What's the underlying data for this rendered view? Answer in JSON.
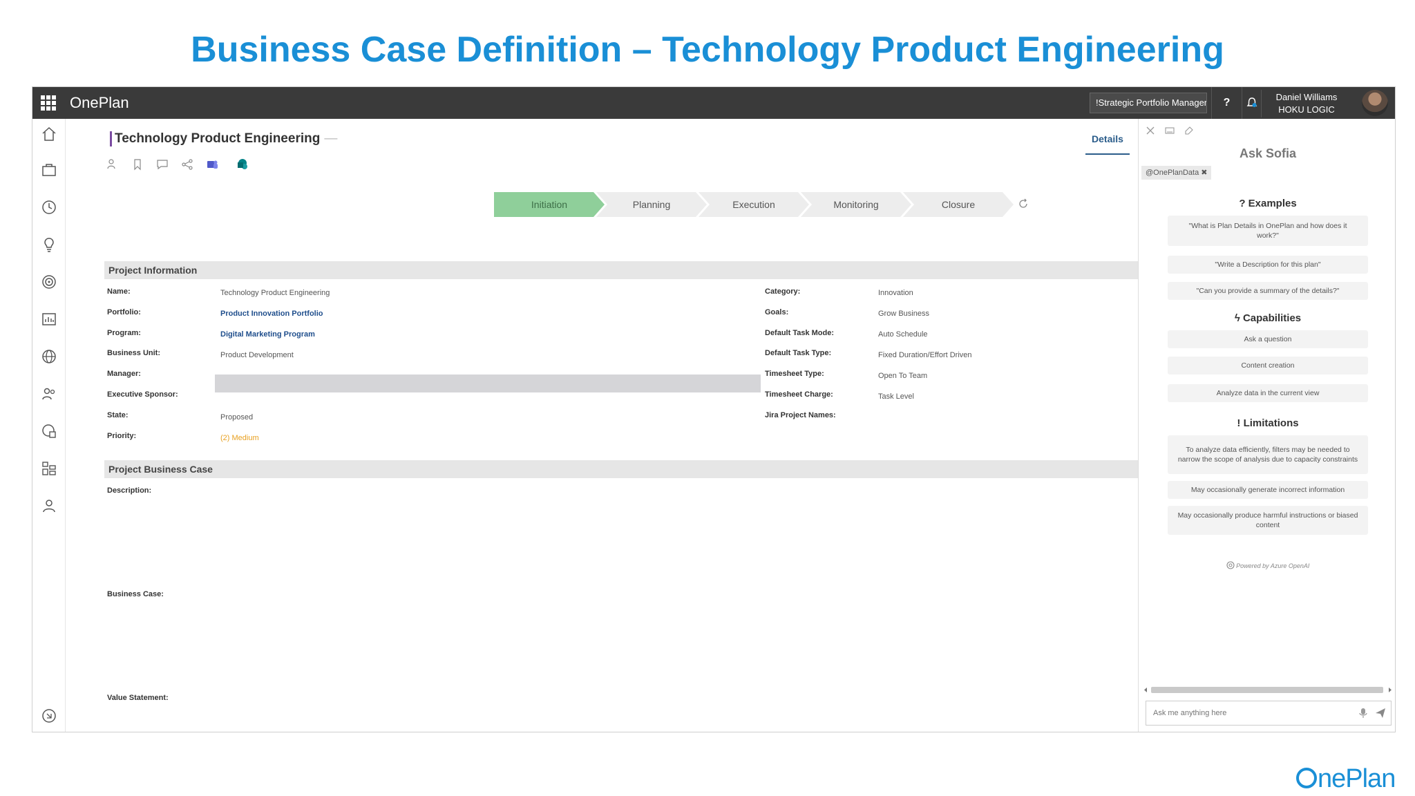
{
  "slide": {
    "title": "Business Case Definition – Technology Product Engineering",
    "brand": "nePlan"
  },
  "topbar": {
    "app_name": "OnePlan",
    "role_selector": "!Strategic Portfolio Manager",
    "help_label": "?",
    "user_name": "Daniel Williams",
    "user_org": "HOKU LOGIC"
  },
  "project": {
    "title": "Technology Product Engineering",
    "title_suffix": "—",
    "tab_details": "Details"
  },
  "stages": [
    "Initiation",
    "Planning",
    "Execution",
    "Monitoring",
    "Closure"
  ],
  "active_stage": "Initiation",
  "project_info": {
    "header": "Project Information",
    "left": [
      {
        "label": "Name:",
        "value": "Technology Product Engineering"
      },
      {
        "label": "Portfolio:",
        "value": "Product Innovation Portfolio"
      },
      {
        "label": "Program:",
        "value": "Digital Marketing Program"
      },
      {
        "label": "Business Unit:",
        "value": "Product Development"
      },
      {
        "label": "Manager:",
        "value": ""
      },
      {
        "label": "Executive Sponsor:",
        "value": ""
      },
      {
        "label": "State:",
        "value": "Proposed"
      },
      {
        "label": "Priority:",
        "value": "(2) Medium"
      }
    ],
    "right": [
      {
        "label": "Category:",
        "value": "Innovation"
      },
      {
        "label": "Goals:",
        "value": "Grow Business"
      },
      {
        "label": "Default Task Mode:",
        "value": "Auto Schedule"
      },
      {
        "label": "Default Task Type:",
        "value": "Fixed Duration/Effort Driven"
      },
      {
        "label": "Timesheet Type:",
        "value": "Open To Team"
      },
      {
        "label": "Timesheet Charge:",
        "value": "Task Level"
      },
      {
        "label": "Jira Project Names:",
        "value": ""
      }
    ]
  },
  "business_case": {
    "header": "Project Business Case",
    "description_label": "Description:",
    "business_case_label": "Business Case:",
    "value_statement_label": "Value Statement:"
  },
  "sofia": {
    "title": "Ask Sofia",
    "tag": "@OnePlanData ✖",
    "examples_title": "? Examples",
    "examples": [
      "\"What is Plan Details in OnePlan and how does it work?\"",
      "\"Write a Description for this plan\"",
      "\"Can you provide a summary of the details?\""
    ],
    "capabilities_title": "Capabilities",
    "capabilities": [
      "Ask a question",
      "Content creation",
      "Analyze data in the current view"
    ],
    "limitations_title": "! Limitations",
    "limitations": [
      "To analyze data efficiently, filters may be needed to narrow the scope of analysis due to capacity constraints",
      "May occasionally generate incorrect information",
      "May occasionally produce harmful instructions or biased content"
    ],
    "powered_by": "Powered by Azure OpenAI",
    "input_placeholder": "Ask me anything here"
  },
  "colors": {
    "title_blue": "#1a8fd6",
    "topbar": "#3a3a3a",
    "stage_active": "#8fcf9a",
    "link_blue": "#1f4e8c",
    "priority_orange": "#e8a020"
  }
}
